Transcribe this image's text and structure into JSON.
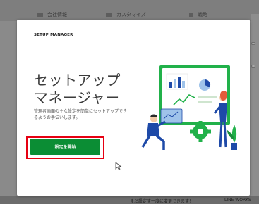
{
  "background": {
    "tabs": [
      "会社情報",
      "カスタマイズ",
      "戦略"
    ],
    "bottom_left": "まだ設定す一度に変更できます！",
    "bottom_right": "LINE WORKS"
  },
  "modal": {
    "header": "SETUP MANAGER",
    "title_line1": "セットアップ",
    "title_line2": "マネージャー",
    "description": "管理者画面の主な設定を簡単にセットアップできるようお手伝いします。",
    "cta_label": "設定を開始"
  },
  "colors": {
    "cta_green": "#0b8d34",
    "highlight_red": "#e60012",
    "illustration_green": "#21b14a",
    "accent_blue": "#1e4aa8",
    "accent_light_blue": "#9fc3ea"
  },
  "icons": [
    "document-icon",
    "magic-wand-icon",
    "chart-icon",
    "gear-icon",
    "pie-chart-icon",
    "cursor-icon"
  ]
}
